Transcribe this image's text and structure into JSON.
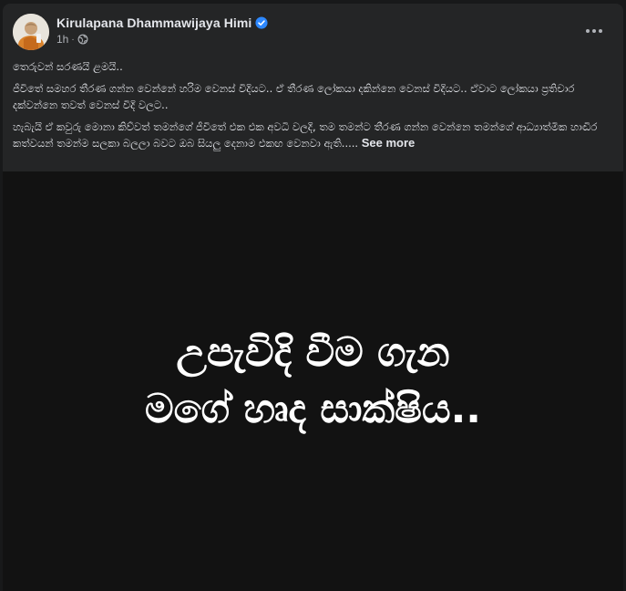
{
  "post": {
    "author": "Kirulapana Dhammawijaya Himi",
    "time": "1h",
    "separator": "·",
    "privacy_icon": "globe-icon",
    "verified_icon": "verified-badge-icon",
    "options_icon": "more-options-icon",
    "paragraphs": [
      "තෙරුවන් සරණයි ළමයි..",
      "ජීවිතේ සමහර තීරණ ගන්න වෙන්නේ හරිම වෙනස් විදියට.. ඒ තීරණ ලෝකයා දකින්නෙ වෙනස් විදියට..  ඒවාට ලෝකයා ප්‍රතිචාර දක්වන්නෙ තවත් වෙනස් විදි වලට..",
      "හැබැයි ඒ කවුරු මොනා කිව්වත් තමන්ගේ ජීවිතේ එක එක අවධි වලදි, තම තමන්ට තීරණ ගන්න වෙන්නෙ තමන්ගේ ආධ්‍යාත්මික හාඬිර කත්වයන් තමන්ම සලකා බලලා බවට ඔබ සියලු  දෙනාම එකඟ වෙනවා ඇති....."
    ],
    "see_more_label": "See more",
    "image_text": [
      "උපැවිදි වීම ගැන",
      "මගේ හෘද සාක්ෂිය.."
    ]
  },
  "colors": {
    "page_bg": "#18191a",
    "card_bg": "#242526",
    "primary_text": "#e4e6eb",
    "secondary_text": "#b0b3b8",
    "verified_blue": "#2d88ff",
    "image_bg": "#121212"
  }
}
